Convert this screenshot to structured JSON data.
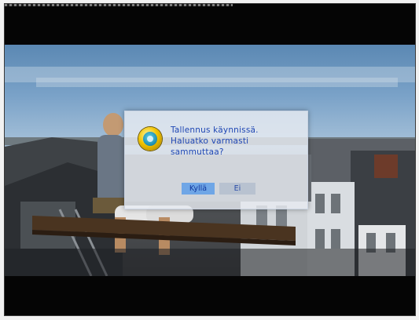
{
  "dialog": {
    "lines": [
      "Tallennus käynnissä.",
      "Haluatko varmasti",
      "sammuttaa?"
    ],
    "icon": "warning-icon",
    "buttons": {
      "yes_label": "Kyllä",
      "no_label": "Ei"
    }
  }
}
